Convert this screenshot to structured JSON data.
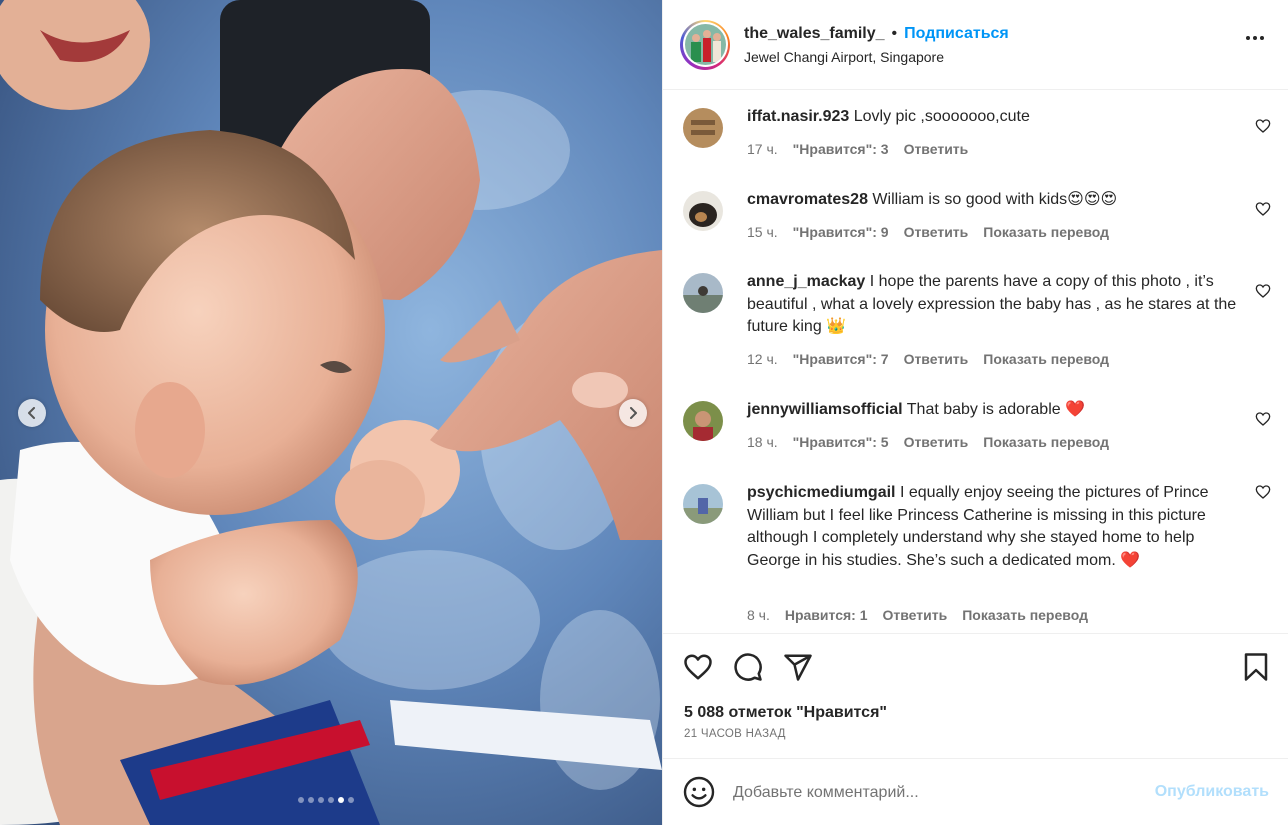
{
  "post": {
    "username": "the_wales_family_",
    "separator": "•",
    "follow_label": "Подписаться",
    "location": "Jewel Changi Airport, Singapore",
    "carousel": {
      "total": 6,
      "active_index": 4
    }
  },
  "comments": [
    {
      "user": "iffat.nasir.923",
      "text": "Lovly pic ,sooooooo,cute",
      "time": "17 ч.",
      "likes": "\"Нравится\": 3",
      "reply": "Ответить",
      "translate": ""
    },
    {
      "user": "cmavromates28",
      "text": "William is so good with kids😍😍😍",
      "time": "15 ч.",
      "likes": "\"Нравится\": 9",
      "reply": "Ответить",
      "translate": "Показать перевод"
    },
    {
      "user": "anne_j_mackay",
      "text": "I hope the parents have a copy of this photo , it’s beautiful , what a lovely expression the baby has , as he stares at the future king 👑",
      "time": "12 ч.",
      "likes": "\"Нравится\": 7",
      "reply": "Ответить",
      "translate": "Показать перевод"
    },
    {
      "user": "jennywilliamsofficial",
      "text": "That baby is adorable ❤️",
      "time": "18 ч.",
      "likes": "\"Нравится\": 5",
      "reply": "Ответить",
      "translate": "Показать перевод"
    },
    {
      "user": "psychicmediumgail",
      "text": "I equally enjoy seeing the pictures of Prince William but I feel like Princess Catherine is missing in this picture although I completely understand why she stayed home to help George in his studies. She’s such a dedicated mom. ❤️",
      "time": "8 ч.",
      "likes": "Нравится: 1",
      "reply": "Ответить",
      "translate": "Показать перевод"
    }
  ],
  "actions": {
    "likes_count": "5 088 отметок \"Нравится\"",
    "time_ago": "21 ЧАСОВ НАЗАД"
  },
  "composer": {
    "placeholder": "Добавьте комментарий...",
    "publish_label": "Опубликовать"
  },
  "colors": {
    "link_blue": "#0095f6",
    "publish_disabled": "#b2dffc",
    "secondary_text": "#737373",
    "heart_red": "#ed1c3a"
  },
  "icons": [
    "chevron-left-icon",
    "chevron-right-icon",
    "more-icon",
    "heart-icon",
    "comment-icon",
    "share-icon",
    "bookmark-icon",
    "emoji-icon"
  ]
}
